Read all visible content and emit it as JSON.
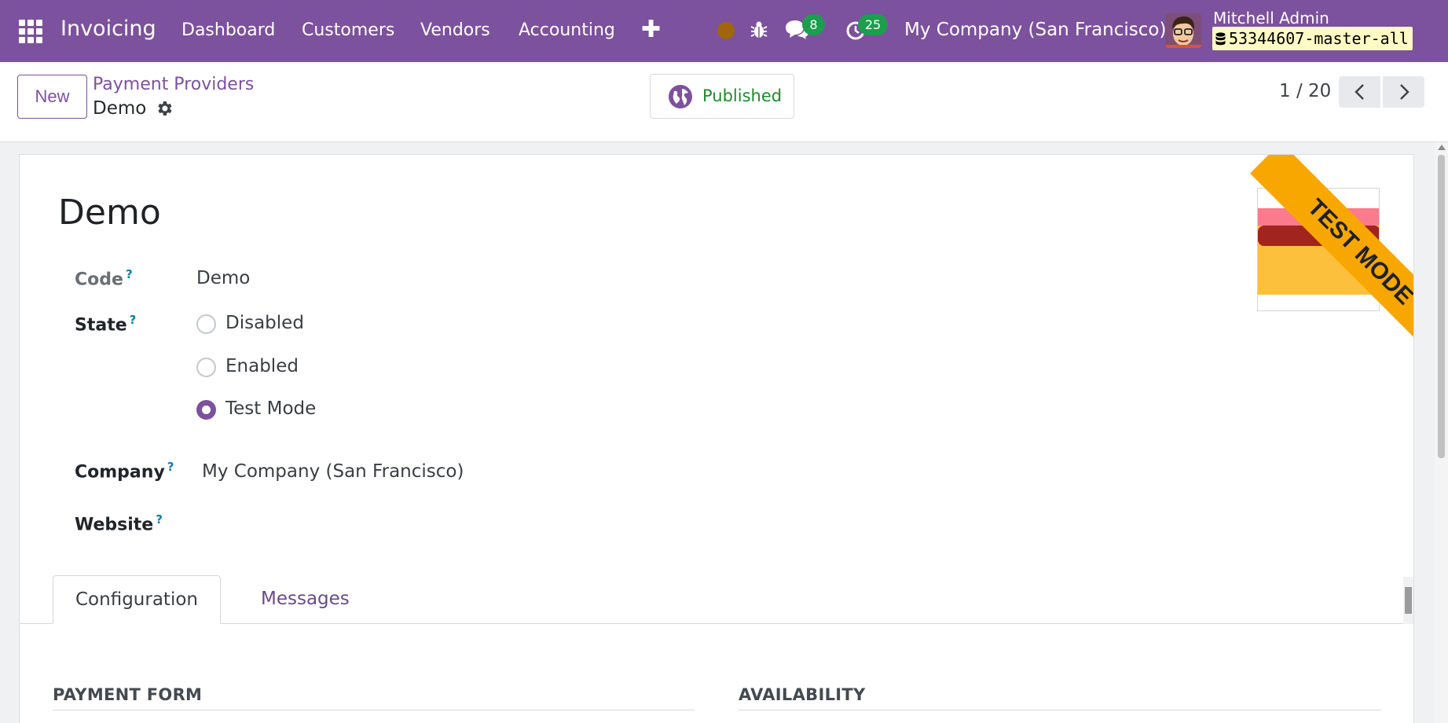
{
  "navbar": {
    "app_name": "Invoicing",
    "menu": [
      "Dashboard",
      "Customers",
      "Vendors",
      "Accounting"
    ],
    "chat_count": "8",
    "activity_count": "25",
    "company": "My Company (San Francisco)",
    "user_name": "Mitchell Admin",
    "database": "53344607-master-all"
  },
  "control_panel": {
    "new_label": "New",
    "breadcrumb": "Payment Providers",
    "record_name": "Demo",
    "published_label": "Published",
    "pager": "1 / 20"
  },
  "form": {
    "title": "Demo",
    "code_label": "Code",
    "code_value": "Demo",
    "state_label": "State",
    "state_options": [
      "Disabled",
      "Enabled",
      "Test Mode"
    ],
    "state_selected": "Test Mode",
    "company_label": "Company",
    "company_value": "My Company (San Francisco)",
    "website_label": "Website",
    "website_value": "",
    "help_mark": "?",
    "ribbon": "TEST MODE"
  },
  "tabs": [
    "Configuration",
    "Messages"
  ],
  "active_tab": "Configuration",
  "sections": {
    "payment_form": "PAYMENT FORM",
    "availability": "AVAILABILITY"
  },
  "colors": {
    "brand": "#7c519d",
    "published": "#1e8a2c",
    "badge": "#1c9e4e",
    "ribbon": "#f8a700"
  }
}
